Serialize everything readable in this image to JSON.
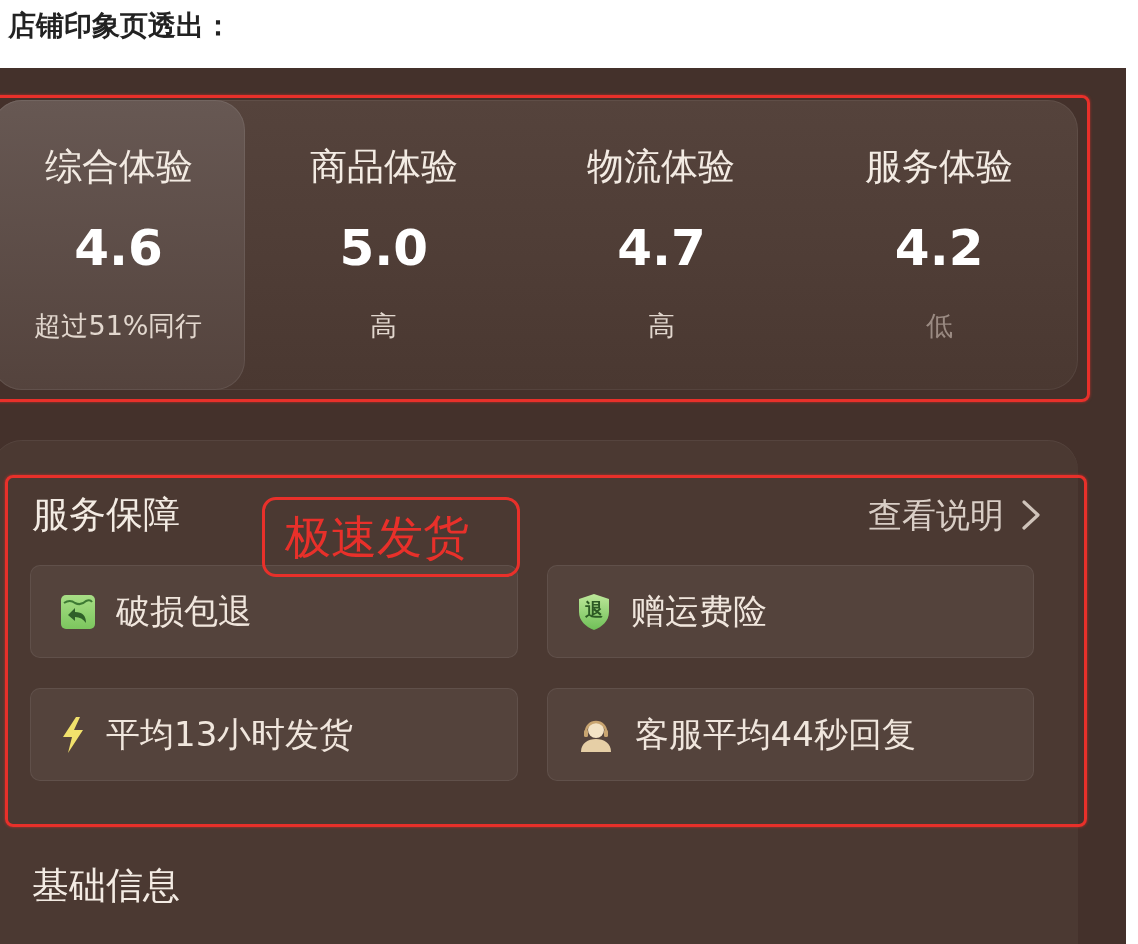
{
  "page_title": "店铺印象页透出：",
  "score_panel": {
    "highlighted": true,
    "scores": [
      {
        "label": "综合体验",
        "value": "4.6",
        "note": "超过51%同行",
        "dimmed": false,
        "selected": true
      },
      {
        "label": "商品体验",
        "value": "5.0",
        "note": "高",
        "dimmed": false,
        "selected": false
      },
      {
        "label": "物流体验",
        "value": "4.7",
        "note": "高",
        "dimmed": false,
        "selected": false
      },
      {
        "label": "服务体验",
        "value": "4.2",
        "note": "低",
        "dimmed": true,
        "selected": false
      }
    ]
  },
  "service_section": {
    "highlighted": true,
    "title": "服务保障",
    "link": "查看说明",
    "callout": "极速发货",
    "items": [
      {
        "kind": "return-box",
        "label": "破损包退"
      },
      {
        "kind": "shield",
        "badge": "退",
        "label": "赠运费险"
      },
      {
        "kind": "lightning",
        "label": "平均13小时发货"
      },
      {
        "kind": "agent",
        "label": "客服平均44秒回复"
      }
    ]
  },
  "basic_info": {
    "title": "基础信息"
  }
}
